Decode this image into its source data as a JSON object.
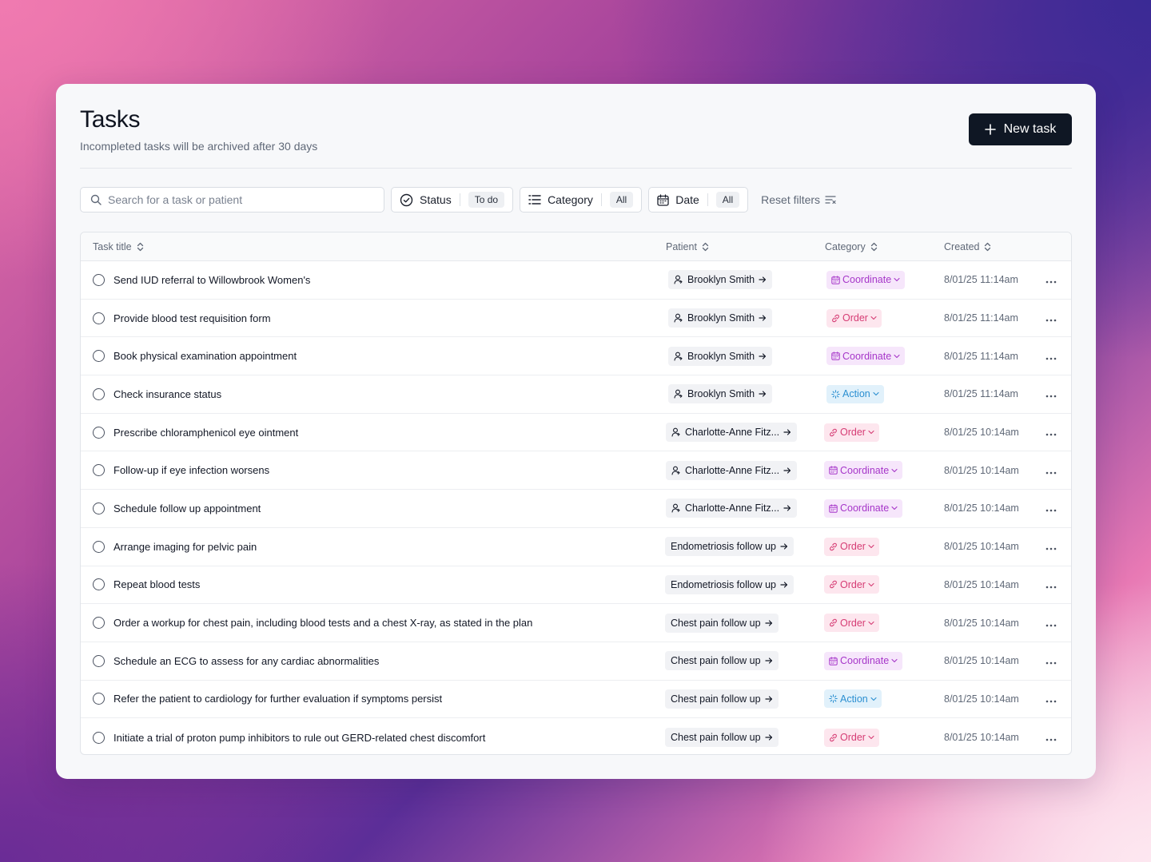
{
  "header": {
    "title": "Tasks",
    "subtitle": "Incompleted tasks will be archived after 30 days",
    "new_task_label": "New task"
  },
  "filters": {
    "search_placeholder": "Search for a task or patient",
    "status": {
      "label": "Status",
      "value": "To do"
    },
    "category": {
      "label": "Category",
      "value": "All"
    },
    "date": {
      "label": "Date",
      "value": "All"
    },
    "reset_label": "Reset filters"
  },
  "table": {
    "columns": {
      "title": "Task title",
      "patient": "Patient",
      "category": "Category",
      "created": "Created"
    },
    "rows": [
      {
        "title": "Send IUD referral to Willowbrook Women's",
        "patient": "Brooklyn Smith",
        "patient_kind": "person",
        "category": "Coordinate",
        "created": "8/01/25 11:14am"
      },
      {
        "title": "Provide blood test requisition form",
        "patient": "Brooklyn Smith",
        "patient_kind": "person",
        "category": "Order",
        "created": "8/01/25 11:14am"
      },
      {
        "title": "Book physical examination appointment",
        "patient": "Brooklyn Smith",
        "patient_kind": "person",
        "category": "Coordinate",
        "created": "8/01/25 11:14am"
      },
      {
        "title": "Check insurance status",
        "patient": "Brooklyn Smith",
        "patient_kind": "person",
        "category": "Action",
        "created": "8/01/25 11:14am"
      },
      {
        "title": "Prescribe chloramphenicol eye ointment",
        "patient": "Charlotte-Anne Fitz...",
        "patient_kind": "person",
        "category": "Order",
        "created": "8/01/25 10:14am"
      },
      {
        "title": "Follow-up if eye infection worsens",
        "patient": "Charlotte-Anne Fitz...",
        "patient_kind": "person",
        "category": "Coordinate",
        "created": "8/01/25 10:14am"
      },
      {
        "title": "Schedule follow up appointment",
        "patient": "Charlotte-Anne Fitz...",
        "patient_kind": "person",
        "category": "Coordinate",
        "created": "8/01/25 10:14am"
      },
      {
        "title": "Arrange imaging for pelvic pain",
        "patient": "Endometriosis follow up",
        "patient_kind": "session",
        "category": "Order",
        "created": "8/01/25 10:14am"
      },
      {
        "title": "Repeat blood tests",
        "patient": "Endometriosis follow up",
        "patient_kind": "session",
        "category": "Order",
        "created": "8/01/25 10:14am"
      },
      {
        "title": "Order a workup for chest pain, including blood tests and a chest X-ray, as stated in the plan",
        "patient": "Chest pain follow up",
        "patient_kind": "session",
        "category": "Order",
        "created": "8/01/25 10:14am"
      },
      {
        "title": "Schedule an ECG to assess for any cardiac abnormalities",
        "patient": "Chest pain follow up",
        "patient_kind": "session",
        "category": "Coordinate",
        "created": "8/01/25 10:14am"
      },
      {
        "title": "Refer the patient to cardiology for further evaluation if symptoms persist",
        "patient": "Chest pain follow up",
        "patient_kind": "session",
        "category": "Action",
        "created": "8/01/25 10:14am"
      },
      {
        "title": "Initiate a trial of proton pump inhibitors to rule out GERD-related chest discomfort",
        "patient": "Chest pain follow up",
        "patient_kind": "session",
        "category": "Order",
        "created": "8/01/25 10:14am"
      }
    ]
  },
  "icons": {
    "person": "user-icon",
    "arrow": "arrow-right-icon",
    "coordinate": "calendar-icon",
    "order": "link-icon",
    "action": "sparkle-icon",
    "more": "more-horizontal-icon"
  },
  "colors": {
    "primary_button": "#0f1724",
    "coordinate": "#a636c9",
    "order": "#d63c74",
    "action": "#2b8fd1"
  }
}
